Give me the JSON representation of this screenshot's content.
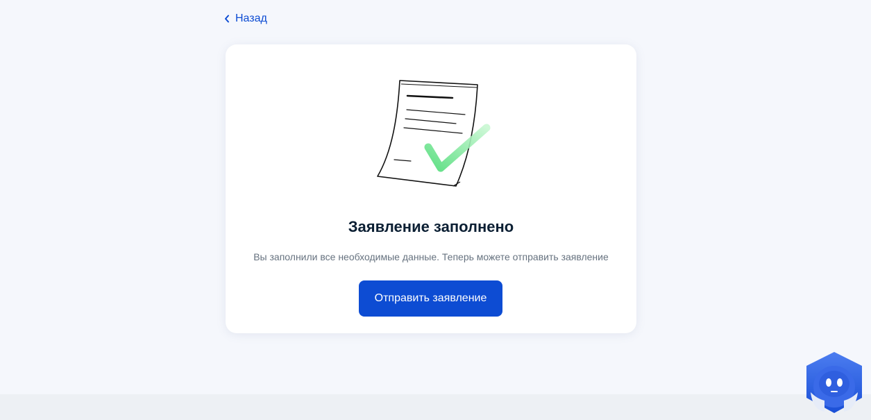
{
  "nav": {
    "back_label": "Назад"
  },
  "result": {
    "title": "Заявление заполнено",
    "message": "Вы заполнили все необходимые данные. Теперь можете отправить заявление",
    "submit_label": "Отправить заявление"
  },
  "icons": {
    "back": "chevron-left-icon",
    "illustration": "document-check-illustration",
    "assistant": "assistant-robot-icon"
  },
  "colors": {
    "background": "#f5f7fc",
    "card": "#ffffff",
    "accent": "#0d4cd3",
    "title": "#0b1f33",
    "subtitle": "#66727f",
    "check": "#5ee88a",
    "footer": "#edf0f4"
  }
}
